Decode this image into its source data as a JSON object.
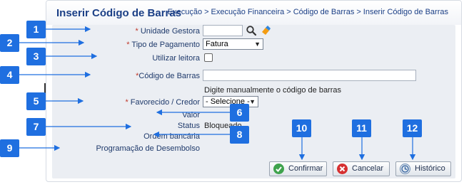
{
  "window": {
    "title": "Inserir Código de Barras",
    "breadcrumb": [
      "Execução",
      "Execução Financeira",
      "Código de Barras",
      "Inserir Código de Barras"
    ],
    "breadcrumb_separator": ">"
  },
  "form": {
    "required_mark": "*",
    "unidade_gestora": {
      "label": "Unidade Gestora",
      "value": ""
    },
    "tipo_pagamento": {
      "label": "Tipo de Pagamento",
      "selected": "Fatura"
    },
    "utilizar_leitora": {
      "label": "Utilizar leitora",
      "checked": false
    },
    "codigo_barras": {
      "label": "Código de Barras",
      "value": "",
      "hint": "Digite manualmente o código de barras"
    },
    "favorecido": {
      "label": "Favorecido / Credor",
      "selected": "- Selecione -"
    },
    "valor": {
      "label": "Valor"
    },
    "status": {
      "label": "Status",
      "value": "Bloqueado"
    },
    "ordem_bancaria": {
      "label": "Ordem bancária"
    },
    "programacao_desembolso": {
      "label": "Programação de Desembolso"
    }
  },
  "buttons": {
    "confirmar": "Confirmar",
    "cancelar": "Cancelar",
    "historico": "Histórico"
  },
  "badges": [
    "1",
    "2",
    "3",
    "4",
    "5",
    "6",
    "7",
    "8",
    "9",
    "10",
    "11",
    "12"
  ],
  "colors": {
    "badge": "#1f6fe0",
    "title": "#1b3f86",
    "panel": "#ebeef3"
  }
}
